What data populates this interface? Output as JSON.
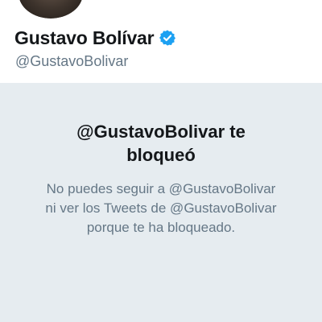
{
  "profile": {
    "display_name": "Gustavo Bolívar",
    "verified_icon": "verified-badge-icon",
    "handle": "@GustavoBolivar"
  },
  "blocked": {
    "title_line1": "@GustavoBolivar te",
    "title_line2": "bloqueó",
    "message_line1": "No puedes seguir a @GustavoBolivar",
    "message_line2": "ni ver los Tweets de @GustavoBolivar",
    "message_line3": "porque te ha bloqueado."
  },
  "colors": {
    "verified_blue": "#1da1f2",
    "panel_background": "#e6ecf0",
    "secondary_text": "#657786",
    "primary_text": "#14171a"
  }
}
